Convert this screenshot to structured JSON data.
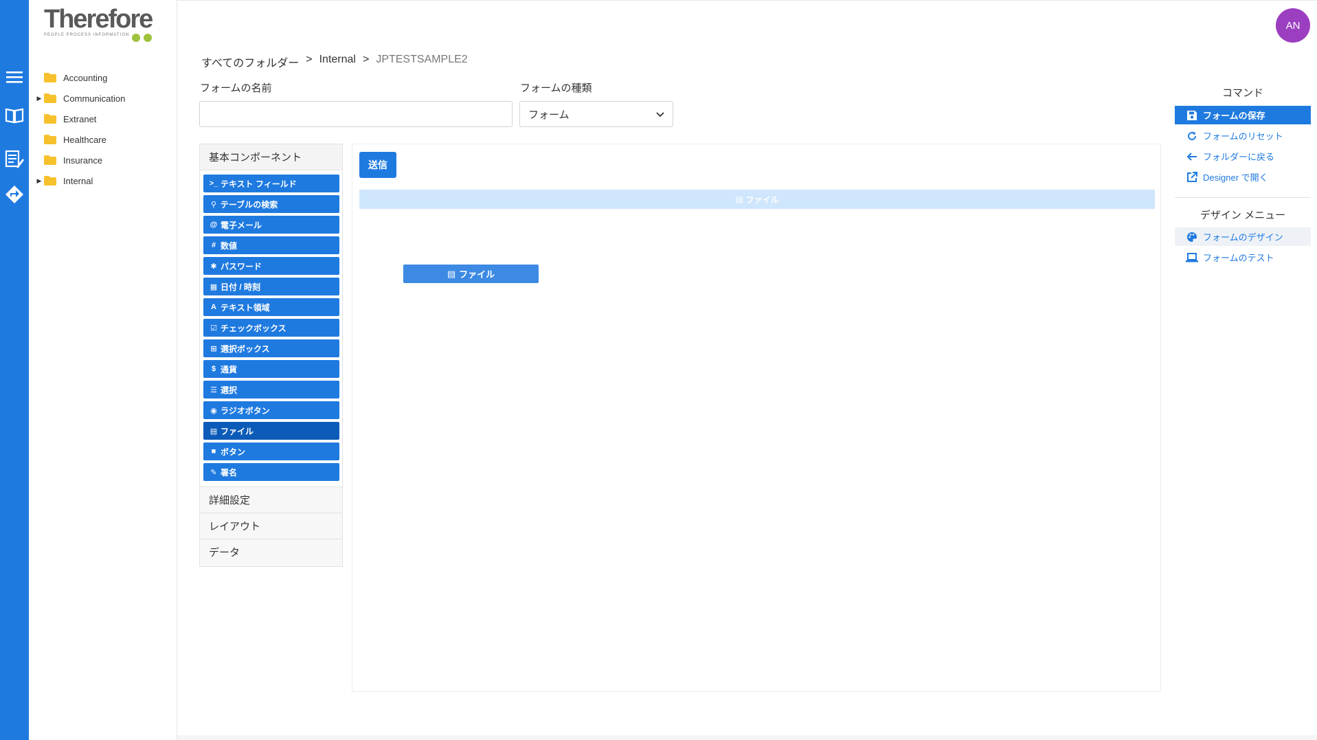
{
  "brand": {
    "logo_text": "Therefore",
    "tagline": "PEOPLE PROCESS INFORMATION",
    "dot_colors": [
      "#9ec23c",
      "#9ec23c"
    ],
    "accent": "#1f7ae0"
  },
  "rail": {
    "icons": [
      "menu-icon",
      "book-icon",
      "form-edit-icon",
      "workflow-diamond-icon"
    ]
  },
  "tree": {
    "items": [
      {
        "label": "Accounting",
        "expandable": false
      },
      {
        "label": "Communication",
        "expandable": true
      },
      {
        "label": "Extranet",
        "expandable": false
      },
      {
        "label": "Healthcare",
        "expandable": false
      },
      {
        "label": "Insurance",
        "expandable": false
      },
      {
        "label": "Internal",
        "expandable": true
      }
    ]
  },
  "breadcrumb": {
    "root": "すべてのフォルダー",
    "folder": "Internal",
    "current": "JPTESTSAMPLE2",
    "separator": ">"
  },
  "form": {
    "name_label": "フォームの名前",
    "name_value": "",
    "type_label": "フォームの種類",
    "type_value": "フォーム"
  },
  "palette": {
    "basic_header": "基本コンポーネント",
    "components": [
      {
        "icon": ">_",
        "label": "テキスト フィールド"
      },
      {
        "icon": "⚲",
        "label": "テーブルの検索"
      },
      {
        "icon": "@",
        "label": "電子メール"
      },
      {
        "icon": "#",
        "label": "数値"
      },
      {
        "icon": "✱",
        "label": "パスワード"
      },
      {
        "icon": "▦",
        "label": "日付 / 時刻"
      },
      {
        "icon": "A",
        "label": "テキスト領域"
      },
      {
        "icon": "☑",
        "label": "チェックボックス"
      },
      {
        "icon": "⊞",
        "label": "選択ボックス"
      },
      {
        "icon": "$",
        "label": "通貨"
      },
      {
        "icon": "☰",
        "label": "選択"
      },
      {
        "icon": "◉",
        "label": "ラジオボタン"
      },
      {
        "icon": "▤",
        "label": "ファイル",
        "active": true
      },
      {
        "icon": "■",
        "label": "ボタン"
      },
      {
        "icon": "✎",
        "label": "署名"
      }
    ],
    "sections": [
      "詳細設定",
      "レイアウト",
      "データ"
    ]
  },
  "canvas": {
    "submit_label": "送信",
    "drop_bar_label": "ファイル",
    "drag_item_label": "ファイル"
  },
  "commands": {
    "header": "コマンド",
    "items": [
      {
        "icon": "save-icon",
        "label": "フォームの保存",
        "active": true
      },
      {
        "icon": "reset-icon",
        "label": "フォームのリセット"
      },
      {
        "icon": "back-arrow-icon",
        "label": "フォルダーに戻る"
      },
      {
        "icon": "external-link-icon",
        "label": "Designer で開く"
      }
    ]
  },
  "design_menu": {
    "header": "デザイン メニュー",
    "items": [
      {
        "icon": "palette-icon",
        "label": "フォームのデザイン",
        "active": true
      },
      {
        "icon": "laptop-icon",
        "label": "フォームのテスト"
      }
    ]
  },
  "user": {
    "initials": "AN",
    "avatar_color": "#9b3fc0"
  }
}
